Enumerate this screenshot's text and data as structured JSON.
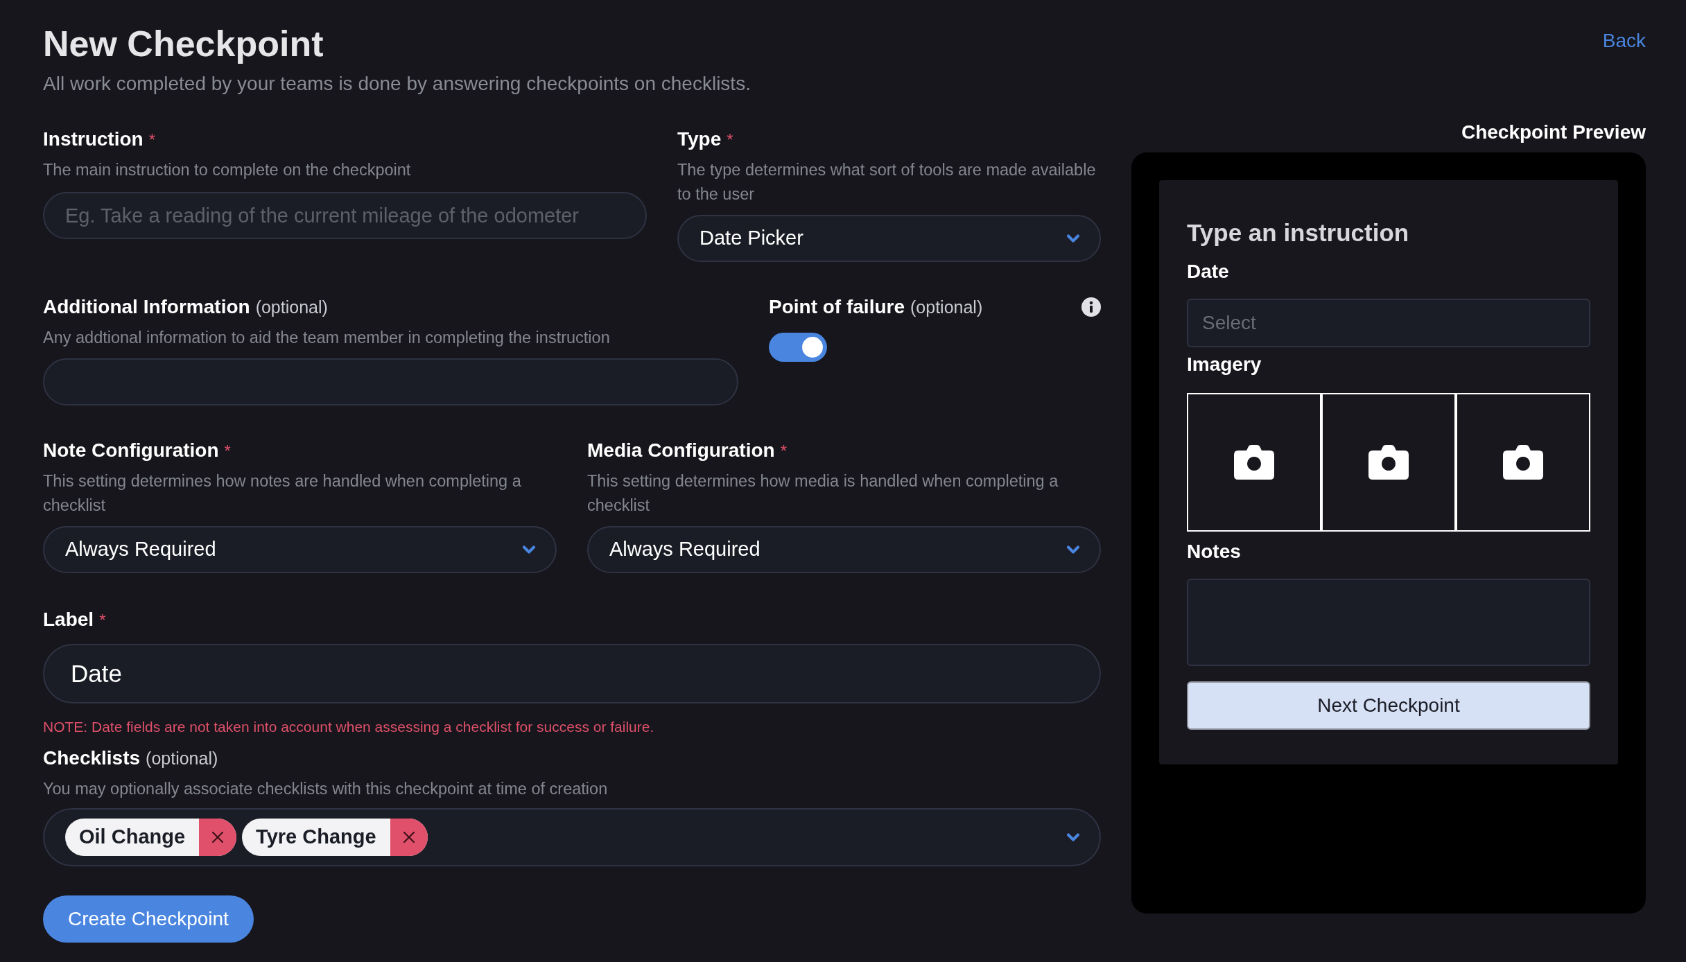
{
  "header": {
    "title": "New Checkpoint",
    "subtitle": "All work completed by your teams is done by answering checkpoints on checklists.",
    "back_link": "Back"
  },
  "instruction": {
    "label": "Instruction",
    "required_mark": "*",
    "help": "The main instruction to complete on the checkpoint",
    "placeholder": "Eg. Take a reading of the current mileage of the odometer"
  },
  "type": {
    "label": "Type",
    "required_mark": "*",
    "help": "The type determines what sort of tools are made available to the user",
    "value": "Date Picker"
  },
  "additional_information": {
    "label": "Additional Information",
    "optional": "(optional)",
    "help": "Any addtional information to aid the team member in completing the instruction"
  },
  "point_of_failure": {
    "label": "Point of failure",
    "optional": "(optional)",
    "on": true
  },
  "note_configuration": {
    "label": "Note Configuration",
    "required_mark": "*",
    "help": "This setting determines how notes are handled when completing a checklist",
    "value": "Always Required"
  },
  "media_configuration": {
    "label": "Media Configuration",
    "required_mark": "*",
    "help": "This setting determines how media is handled when completing a checklist",
    "value": "Always Required"
  },
  "label_field": {
    "label": "Label",
    "required_mark": "*",
    "value": "Date"
  },
  "note": "NOTE: Date fields are not taken into account when assessing a checklist for success or failure.",
  "checklists": {
    "label": "Checklists",
    "optional": "(optional)",
    "help": "You may optionally associate checklists with this checkpoint at time of creation",
    "tags": [
      {
        "label": "Oil Change"
      },
      {
        "label": "Tyre Change"
      }
    ]
  },
  "create_button": "Create Checkpoint",
  "preview": {
    "title": "Checkpoint Preview",
    "instruction": "Type an instruction",
    "date_label": "Date",
    "date_placeholder": "Select",
    "imagery_label": "Imagery",
    "image_slots": [
      {
        "kind": "camera"
      },
      {
        "kind": "camera"
      },
      {
        "kind": "camera"
      }
    ],
    "notes_label": "Notes",
    "next_button": "Next Checkpoint"
  }
}
